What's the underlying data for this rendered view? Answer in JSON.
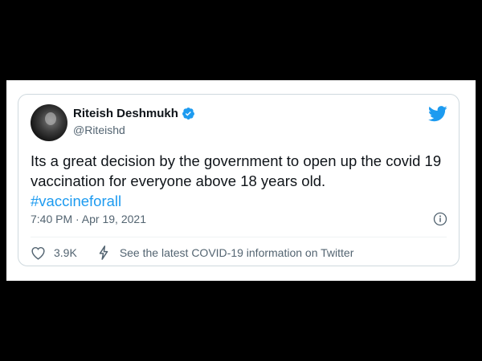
{
  "tweet": {
    "author_name": "Riteish Deshmukh",
    "handle": "@Riteishd",
    "text": "Its a great decision by the government to open up the covid 19 vaccination for everyone above 18 years old.",
    "hashtag": "#vaccineforall",
    "timestamp": "7:40 PM · Apr 19, 2021",
    "like_count": "3.9K",
    "covid_info_label": "See the latest COVID-19 information on Twitter"
  },
  "icons": {
    "verified": "verified-badge-icon",
    "brand": "twitter-bird-icon",
    "info": "info-icon",
    "like": "heart-icon",
    "covid": "lightning-bolt-icon"
  },
  "colors": {
    "background": "#000000",
    "card": "#ffffff",
    "accent": "#1d9bf0",
    "text": "#0f1419",
    "secondary_text": "#536471",
    "border": "#cfd9de"
  }
}
